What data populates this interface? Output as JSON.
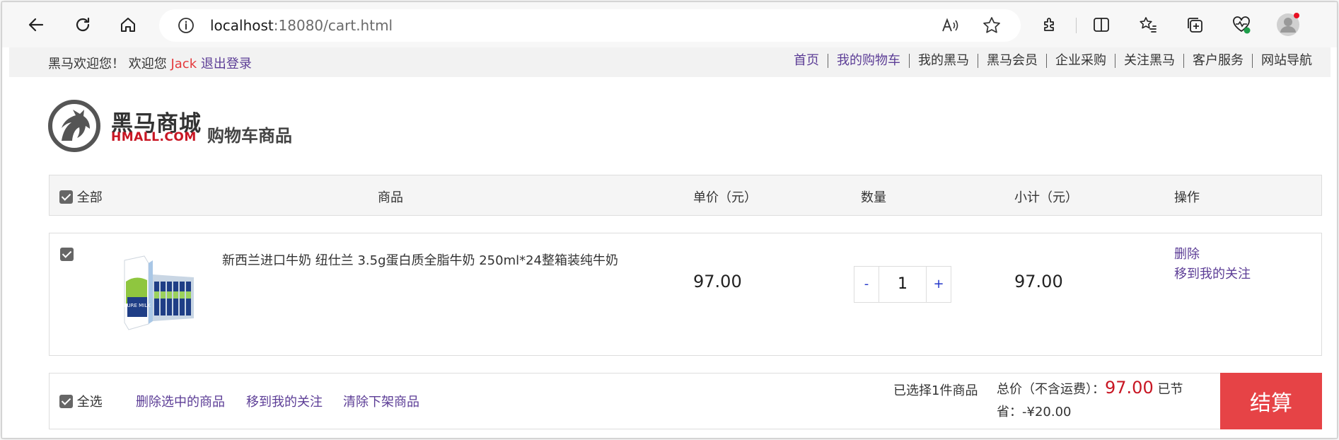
{
  "browser": {
    "url_host": "localhost",
    "url_path": ":18080/cart.html"
  },
  "shortcut": {
    "welcome": "黑马欢迎您！ 欢迎您 ",
    "user": "Jack",
    "logout": " 退出登录",
    "links": [
      "首页",
      "我的购物车",
      "我的黑马",
      "黑马会员",
      "企业采购",
      "关注黑马",
      "客户服务",
      "网站导航"
    ]
  },
  "header": {
    "logo_title": "黑马商城",
    "logo_sub": "HMALL.COM",
    "page_title": "购物车商品"
  },
  "table": {
    "col_all": "全部",
    "col_product": "商品",
    "col_price": "单价（元）",
    "col_qty": "数量",
    "col_subtotal": "小计（元）",
    "col_ops": "操作"
  },
  "items": [
    {
      "name": "新西兰进口牛奶 纽仕兰 3.5g蛋白质全脂牛奶 250ml*24整箱装纯牛奶",
      "price": "97.00",
      "qty": "1",
      "minus": "-",
      "plus": "+",
      "subtotal": "97.00",
      "op_delete": "删除",
      "op_follow": "移到我的关注",
      "image_text": "PURE MILK"
    }
  ],
  "footer": {
    "select_all": "全选",
    "delete_selected": "删除选中的商品",
    "move_follow": "移到我的关注",
    "clear_offline": "清除下架商品",
    "selected_count": "已选择1件商品",
    "total_label": "总价（不含运费）：",
    "total_amount": "97.00",
    "saved_label": " 已节省：",
    "saved_amount": "-¥20.00",
    "checkout": "结算"
  },
  "colors": {
    "accent_red": "#e64346",
    "link_purple": "#5c3d96",
    "price_red": "#c81623"
  }
}
